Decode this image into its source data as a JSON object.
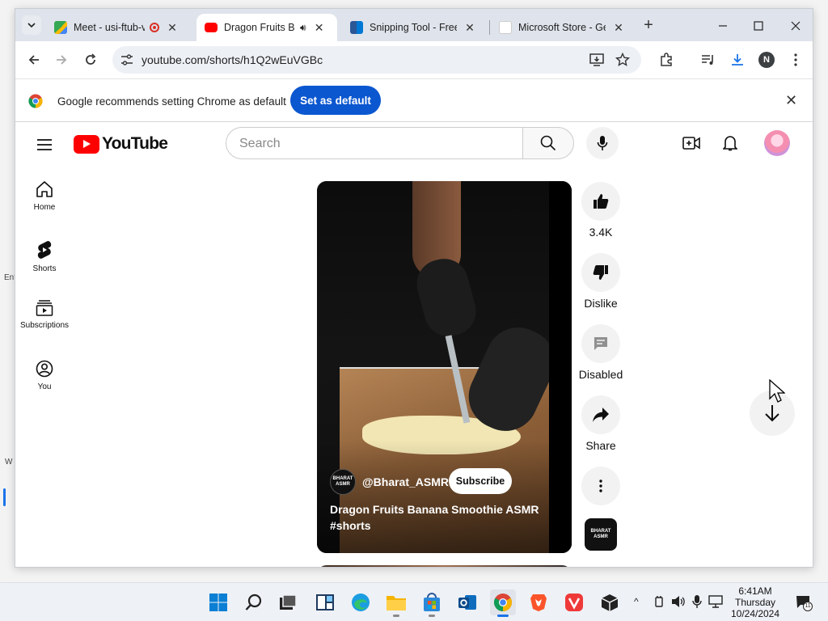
{
  "desktop": {
    "left_text_1": "Ent",
    "left_text_2": "W"
  },
  "browser": {
    "tabs": [
      {
        "title": "Meet - usi-ftub-v",
        "favicon": "google-meet-icon",
        "recording": true
      },
      {
        "title": "Dragon Fruits Ba",
        "favicon": "youtube-icon",
        "audio": true,
        "active": true
      },
      {
        "title": "Snipping Tool - Free",
        "favicon": "store-icon"
      },
      {
        "title": "Microsoft Store - Ge",
        "favicon": "store-icon"
      }
    ],
    "url": "youtube.com/shorts/h1Q2wEuVGBc",
    "profile_initial": "N",
    "infobar": {
      "message": "Google recommends setting Chrome as default",
      "button": "Set as default"
    }
  },
  "youtube": {
    "logo_text": "YouTube",
    "search_placeholder": "Search",
    "guide": [
      {
        "label": "Home",
        "icon": "home-icon"
      },
      {
        "label": "Shorts",
        "icon": "shorts-icon"
      },
      {
        "label": "Subscriptions",
        "icon": "subscriptions-icon"
      },
      {
        "label": "You",
        "icon": "you-icon"
      }
    ],
    "short": {
      "channel": "@Bharat_ASMR",
      "subscribe": "Subscribe",
      "title": "Dragon Fruits Banana Smoothie ASMR",
      "hashtag": "#shorts",
      "channel_badge": "BHARAT ASMR"
    },
    "actions": {
      "like_count": "3.4K",
      "dislike": "Dislike",
      "comments": "Disabled",
      "share": "Share"
    }
  },
  "taskbar": {
    "time": "6:41AM",
    "day": "Thursday",
    "date": "10/24/2024",
    "notification_count": "11"
  }
}
